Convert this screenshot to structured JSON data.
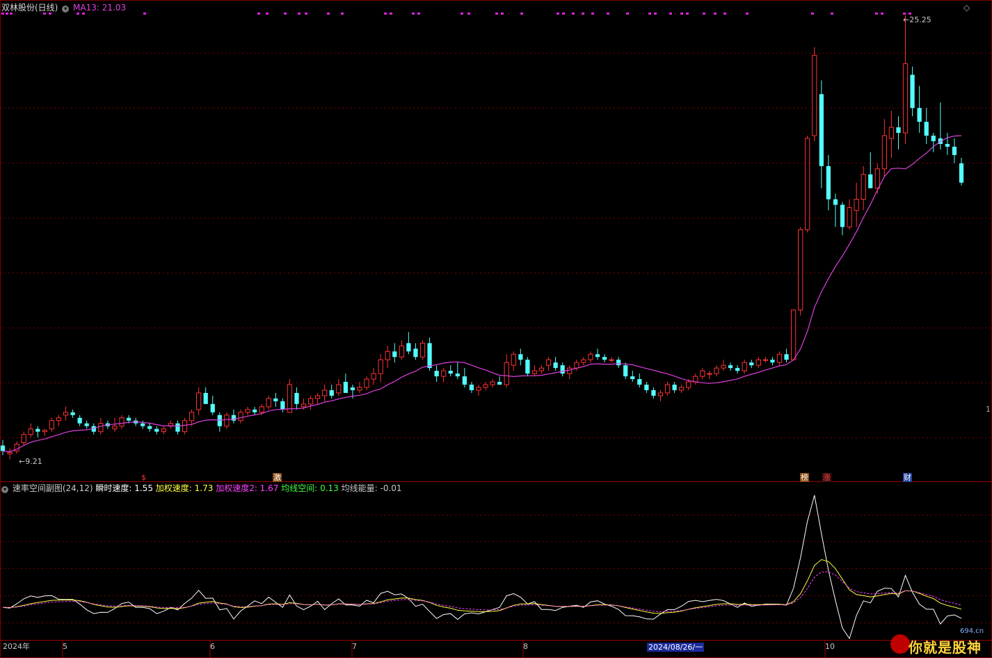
{
  "header": {
    "stock_name": "双林股份(日线)",
    "ma_label": "MA13: 21.03",
    "collapse_icon": "chevron-down-icon",
    "corner_icon": "diamond-icon"
  },
  "indicator_header": {
    "name": "速率空间副图(24,12)",
    "speed": "瞬时速度: 1.55",
    "wspeed": "加权速度: 1.73",
    "wspeed2": "加权速度2: 1.67",
    "maspace": "均线空间: 0.13",
    "maenergy": "均线能量: -0.01"
  },
  "price_labels": {
    "high": "25.25",
    "low": "9.21"
  },
  "event_tags": [
    {
      "text": "$",
      "color": "#ff3030"
    },
    {
      "text": "激",
      "color": "#ffffff",
      "bg": "#8a4a10"
    },
    {
      "text": "榜",
      "color": "#ffffff",
      "bg": "#8a4a10"
    },
    {
      "text": "涨",
      "color": "#ff4040",
      "bg": "#3a1010"
    },
    {
      "text": "财",
      "color": "#ffffff",
      "bg": "#2040a0"
    }
  ],
  "x_labels": [
    {
      "text": "2024年"
    },
    {
      "text": "5"
    },
    {
      "text": "6"
    },
    {
      "text": "7"
    },
    {
      "text": "8"
    },
    {
      "text": "10"
    }
  ],
  "date_cursor": "2024/08/26/一",
  "right_edge_label": "1",
  "watermark": {
    "main": "你就是股神",
    "site": "694.cn"
  },
  "colors": {
    "up": "#ff3333",
    "down": "#54ffff",
    "ma": "#e040e0",
    "grid": "#7a0000",
    "speed": "#ffffff",
    "wspeed": "#ffff40",
    "wspeed2": "#ff40ff"
  },
  "chart_data": {
    "type": "candlestick",
    "title": "双林股份(日线)",
    "ma_period": 13,
    "ma_last": 21.03,
    "ohlc": [
      [
        9.7,
        9.9,
        9.35,
        9.5
      ],
      [
        9.4,
        9.6,
        9.2,
        9.45
      ],
      [
        9.5,
        9.85,
        9.4,
        9.75
      ],
      [
        9.8,
        10.2,
        9.7,
        10.1
      ],
      [
        10.1,
        10.5,
        10.0,
        10.3
      ],
      [
        10.3,
        10.4,
        10.0,
        10.2
      ],
      [
        10.2,
        10.3,
        10.05,
        10.25
      ],
      [
        10.3,
        10.7,
        10.2,
        10.6
      ],
      [
        10.6,
        10.8,
        10.4,
        10.7
      ],
      [
        10.8,
        11.1,
        10.6,
        10.9
      ],
      [
        10.9,
        11.0,
        10.7,
        10.8
      ],
      [
        10.7,
        10.8,
        10.4,
        10.5
      ],
      [
        10.5,
        10.6,
        10.3,
        10.4
      ],
      [
        10.4,
        10.5,
        10.1,
        10.2
      ],
      [
        10.2,
        10.7,
        10.1,
        10.5
      ],
      [
        10.5,
        10.6,
        10.3,
        10.4
      ],
      [
        10.3,
        10.7,
        10.2,
        10.4
      ],
      [
        10.4,
        10.8,
        10.3,
        10.7
      ],
      [
        10.7,
        10.8,
        10.5,
        10.6
      ],
      [
        10.6,
        10.7,
        10.4,
        10.5
      ],
      [
        10.5,
        10.6,
        10.3,
        10.4
      ],
      [
        10.4,
        10.5,
        10.2,
        10.3
      ],
      [
        10.3,
        10.4,
        10.1,
        10.2
      ],
      [
        10.2,
        10.4,
        10.1,
        10.3
      ],
      [
        10.4,
        10.6,
        10.3,
        10.5
      ],
      [
        10.5,
        10.6,
        10.1,
        10.2
      ],
      [
        10.2,
        10.7,
        10.1,
        10.6
      ],
      [
        10.6,
        11.0,
        10.4,
        10.9
      ],
      [
        11.0,
        11.8,
        10.8,
        11.6
      ],
      [
        11.6,
        11.8,
        11.3,
        11.2
      ],
      [
        11.2,
        11.5,
        10.8,
        10.9
      ],
      [
        10.8,
        10.9,
        10.2,
        10.4
      ],
      [
        10.4,
        10.9,
        10.3,
        10.8
      ],
      [
        10.8,
        11.0,
        10.5,
        10.6
      ],
      [
        10.6,
        11.0,
        10.5,
        10.9
      ],
      [
        10.9,
        11.1,
        10.8,
        11.0
      ],
      [
        11.0,
        11.1,
        10.8,
        10.9
      ],
      [
        10.9,
        11.2,
        10.8,
        11.1
      ],
      [
        11.1,
        11.5,
        11.0,
        11.4
      ],
      [
        11.4,
        11.6,
        11.1,
        11.3
      ],
      [
        11.3,
        11.4,
        10.9,
        11.0
      ],
      [
        10.9,
        12.1,
        10.9,
        11.9
      ],
      [
        11.6,
        11.8,
        11.0,
        11.2
      ],
      [
        11.1,
        11.4,
        11.0,
        11.2
      ],
      [
        11.2,
        11.5,
        11.0,
        11.4
      ],
      [
        11.4,
        11.6,
        11.2,
        11.5
      ],
      [
        11.5,
        11.9,
        11.3,
        11.7
      ],
      [
        11.7,
        11.9,
        11.4,
        11.5
      ],
      [
        11.6,
        12.1,
        11.5,
        11.9
      ],
      [
        12.0,
        12.3,
        11.7,
        11.6
      ],
      [
        11.8,
        11.9,
        11.4,
        11.7
      ],
      [
        11.7,
        12.0,
        11.6,
        11.8
      ],
      [
        11.8,
        12.2,
        11.7,
        12.1
      ],
      [
        12.1,
        12.5,
        11.9,
        12.3
      ],
      [
        12.3,
        13.0,
        12.0,
        12.8
      ],
      [
        12.8,
        13.3,
        12.5,
        13.1
      ],
      [
        13.1,
        13.4,
        12.7,
        12.9
      ],
      [
        12.9,
        13.5,
        12.8,
        13.3
      ],
      [
        13.4,
        13.8,
        13.0,
        13.1
      ],
      [
        13.2,
        13.4,
        12.8,
        12.9
      ],
      [
        12.9,
        13.5,
        12.8,
        13.4
      ],
      [
        13.4,
        13.6,
        12.4,
        12.5
      ],
      [
        12.4,
        12.6,
        12.0,
        12.2
      ],
      [
        12.2,
        12.5,
        12.0,
        12.4
      ],
      [
        12.4,
        12.6,
        12.2,
        12.3
      ],
      [
        12.3,
        12.7,
        12.1,
        12.2
      ],
      [
        12.2,
        12.5,
        11.8,
        11.9
      ],
      [
        11.9,
        12.0,
        11.6,
        11.7
      ],
      [
        11.7,
        11.9,
        11.5,
        11.8
      ],
      [
        11.8,
        12.0,
        11.7,
        11.9
      ],
      [
        11.9,
        12.1,
        11.8,
        12.0
      ],
      [
        12.0,
        12.2,
        11.9,
        11.9
      ],
      [
        11.9,
        13.0,
        11.8,
        12.7
      ],
      [
        12.6,
        13.1,
        12.4,
        13.0
      ],
      [
        13.0,
        13.2,
        12.6,
        12.8
      ],
      [
        12.8,
        12.9,
        12.2,
        12.3
      ],
      [
        12.3,
        12.6,
        12.2,
        12.4
      ],
      [
        12.4,
        12.6,
        12.3,
        12.5
      ],
      [
        12.6,
        12.9,
        12.4,
        12.8
      ],
      [
        12.7,
        12.9,
        12.4,
        12.5
      ],
      [
        12.6,
        12.7,
        12.2,
        12.3
      ],
      [
        12.3,
        12.6,
        12.1,
        12.5
      ],
      [
        12.5,
        12.8,
        12.4,
        12.7
      ],
      [
        12.7,
        12.9,
        12.6,
        12.8
      ],
      [
        12.8,
        13.1,
        12.7,
        13.0
      ],
      [
        13.0,
        13.2,
        12.8,
        12.9
      ],
      [
        12.9,
        13.0,
        12.7,
        12.8
      ],
      [
        12.8,
        12.9,
        12.7,
        12.8
      ],
      [
        12.8,
        12.9,
        12.5,
        12.6
      ],
      [
        12.6,
        12.7,
        12.1,
        12.2
      ],
      [
        12.2,
        12.4,
        12.0,
        12.1
      ],
      [
        12.1,
        12.3,
        11.8,
        11.9
      ],
      [
        11.9,
        12.0,
        11.6,
        11.7
      ],
      [
        11.7,
        11.8,
        11.4,
        11.5
      ],
      [
        11.5,
        11.7,
        11.3,
        11.6
      ],
      [
        11.6,
        12.0,
        11.5,
        11.9
      ],
      [
        11.9,
        12.0,
        11.6,
        11.7
      ],
      [
        11.7,
        11.9,
        11.6,
        11.8
      ],
      [
        11.8,
        12.1,
        11.7,
        12.0
      ],
      [
        12.0,
        12.3,
        11.9,
        12.2
      ],
      [
        12.2,
        12.5,
        12.1,
        12.4
      ],
      [
        12.3,
        12.4,
        12.1,
        12.3
      ],
      [
        12.3,
        12.6,
        12.2,
        12.5
      ],
      [
        12.5,
        12.8,
        12.4,
        12.6
      ],
      [
        12.6,
        12.7,
        12.4,
        12.5
      ],
      [
        12.5,
        12.6,
        12.3,
        12.4
      ],
      [
        12.4,
        12.8,
        12.3,
        12.7
      ],
      [
        12.7,
        12.8,
        12.5,
        12.6
      ],
      [
        12.6,
        12.9,
        12.5,
        12.8
      ],
      [
        12.8,
        12.9,
        12.7,
        12.8
      ],
      [
        12.8,
        12.9,
        12.6,
        12.7
      ],
      [
        12.7,
        13.1,
        12.6,
        13.0
      ],
      [
        13.0,
        13.2,
        12.7,
        12.8
      ],
      [
        12.8,
        14.6,
        12.8,
        14.6
      ],
      [
        14.6,
        17.6,
        14.4,
        17.5
      ],
      [
        17.5,
        20.9,
        17.4,
        20.8
      ],
      [
        20.9,
        24.1,
        20.7,
        23.8
      ],
      [
        22.4,
        22.9,
        19.0,
        19.8
      ],
      [
        19.8,
        20.2,
        18.2,
        18.6
      ],
      [
        18.6,
        18.8,
        17.6,
        18.4
      ],
      [
        18.4,
        18.5,
        17.3,
        17.6
      ],
      [
        17.6,
        18.6,
        17.5,
        18.3
      ],
      [
        18.2,
        19.2,
        17.6,
        18.6
      ],
      [
        18.6,
        19.8,
        18.2,
        19.5
      ],
      [
        19.5,
        20.3,
        19.2,
        19.0
      ],
      [
        19.0,
        19.9,
        18.8,
        19.7
      ],
      [
        19.7,
        21.5,
        19.4,
        20.9
      ],
      [
        20.8,
        21.8,
        20.1,
        21.2
      ],
      [
        21.2,
        21.6,
        20.4,
        21.0
      ],
      [
        21.0,
        25.25,
        20.6,
        23.5
      ],
      [
        23.1,
        23.4,
        21.6,
        21.9
      ],
      [
        21.9,
        22.7,
        21.0,
        21.4
      ],
      [
        21.4,
        21.9,
        20.6,
        20.9
      ],
      [
        20.9,
        21.0,
        20.3,
        20.7
      ],
      [
        20.8,
        22.1,
        20.4,
        20.6
      ],
      [
        20.6,
        21.0,
        20.2,
        20.5
      ],
      [
        20.5,
        20.8,
        19.9,
        20.2
      ],
      [
        19.9,
        20.1,
        19.1,
        19.2
      ]
    ],
    "indicator": {
      "name": "速率空间副图(24,12)",
      "series": [
        {
          "name": "瞬时速度",
          "last": 1.55
        },
        {
          "name": "加权速度",
          "last": 1.73
        },
        {
          "name": "加权速度2",
          "last": 1.67
        },
        {
          "name": "均线空间",
          "last": 0.13
        },
        {
          "name": "均线能量",
          "last": -0.01
        }
      ]
    }
  }
}
